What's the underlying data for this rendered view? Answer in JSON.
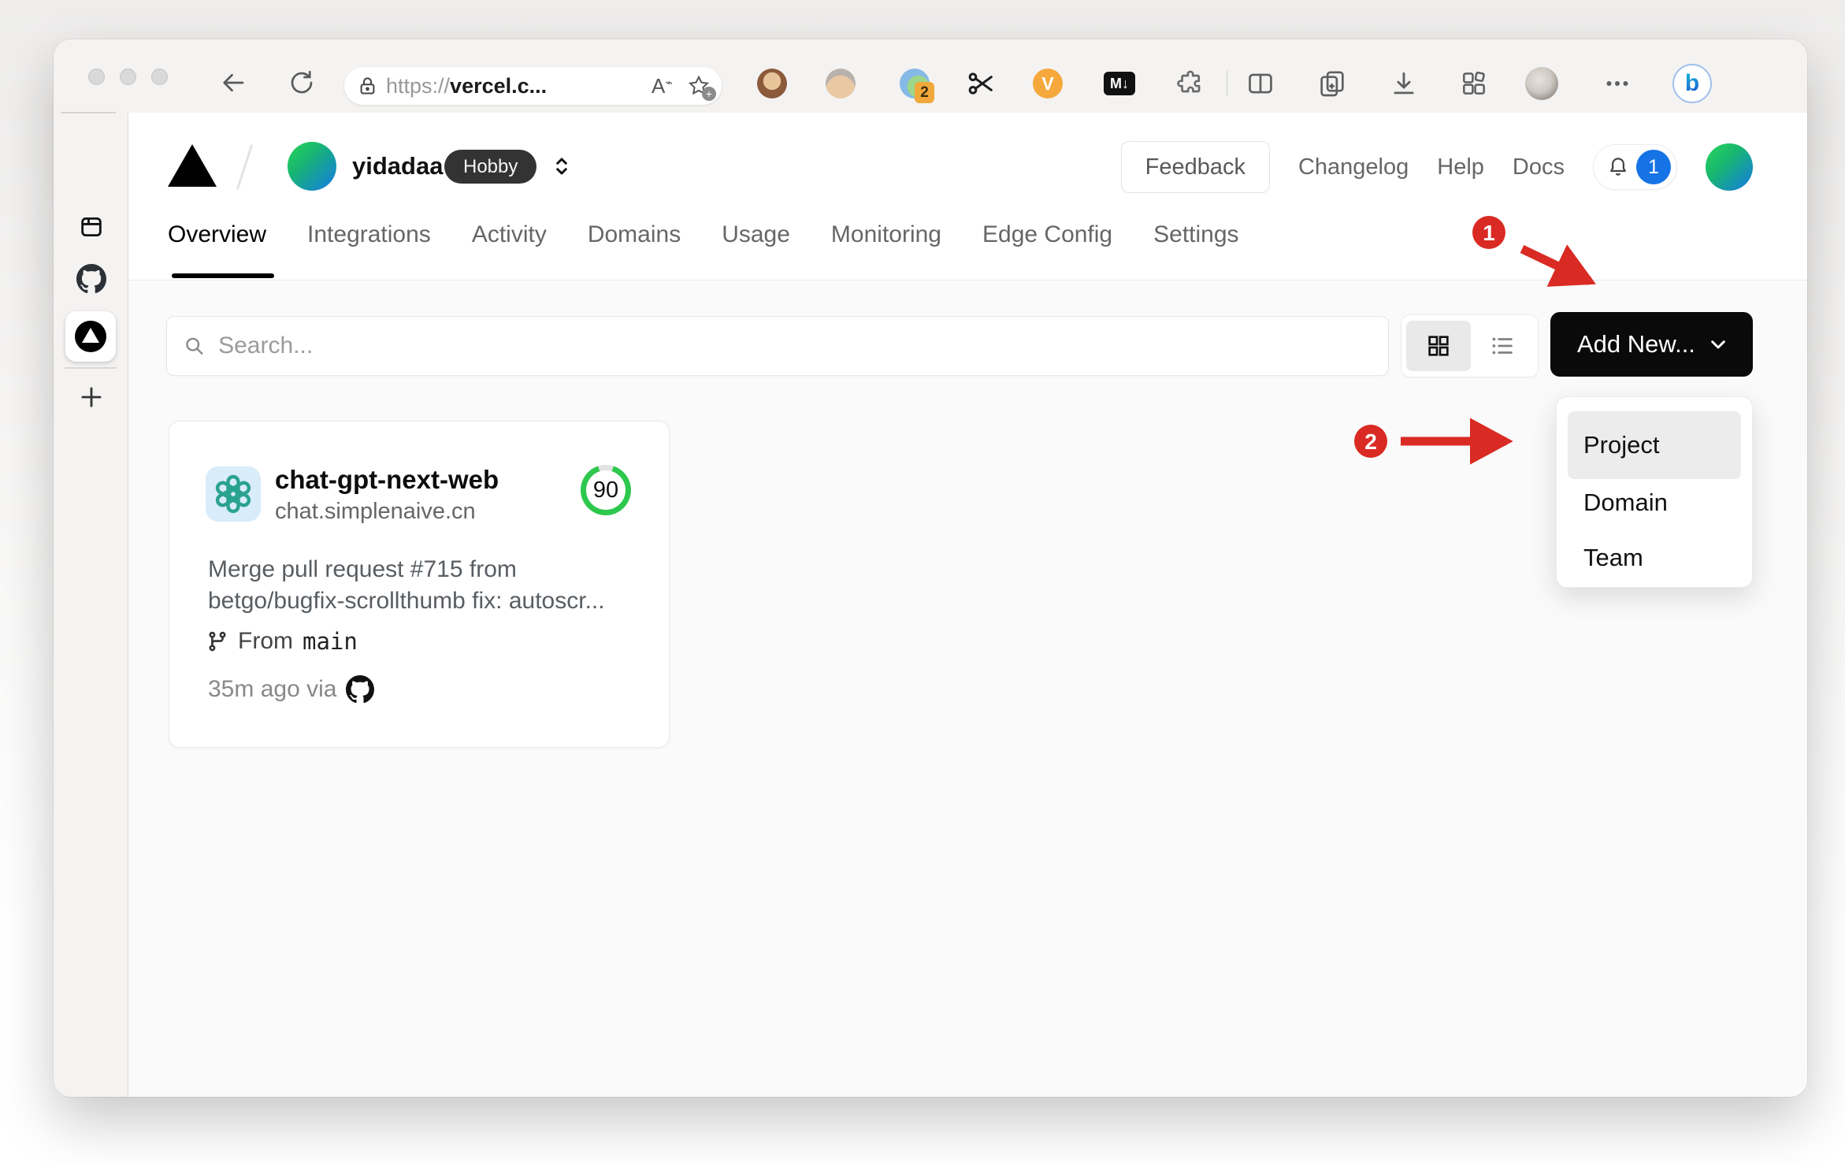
{
  "browser": {
    "url_scheme": "https://",
    "url_host": "vercel.c...",
    "read_aloud_label": "A",
    "tab_group_badge": "2",
    "v_extension_label": "V",
    "markdown_extension_label": "M↓",
    "bing_label": "b"
  },
  "vercel_header": {
    "team_name": "yidadaa",
    "plan_badge": "Hobby",
    "feedback_label": "Feedback",
    "changelog_label": "Changelog",
    "help_label": "Help",
    "docs_label": "Docs",
    "notification_count": "1"
  },
  "nav_tabs": [
    {
      "label": "Overview",
      "active": true
    },
    {
      "label": "Integrations"
    },
    {
      "label": "Activity"
    },
    {
      "label": "Domains"
    },
    {
      "label": "Usage"
    },
    {
      "label": "Monitoring"
    },
    {
      "label": "Edge Config"
    },
    {
      "label": "Settings"
    }
  ],
  "toolbar": {
    "search_placeholder": "Search...",
    "add_new_label": "Add New..."
  },
  "add_new_menu": {
    "items": [
      "Project",
      "Domain",
      "Team"
    ],
    "highlighted": "Project"
  },
  "project_card": {
    "name": "chat-gpt-next-web",
    "domain": "chat.simplenaive.cn",
    "score": "90",
    "commit_message_line1": "Merge pull request #715 from",
    "commit_message_line2": "betgo/bugfix-scrollthumb fix: autoscr...",
    "branch_label": "From",
    "branch_name": "main",
    "deploy_meta": "35m ago via"
  },
  "annotations": {
    "step1": "1",
    "step2": "2"
  },
  "colors": {
    "annotation_red": "#d92b23",
    "badge_blue": "#1673e6",
    "score_green": "#2dc84d",
    "button_black": "#0a0a0a",
    "openai_teal": "#2aa292"
  }
}
